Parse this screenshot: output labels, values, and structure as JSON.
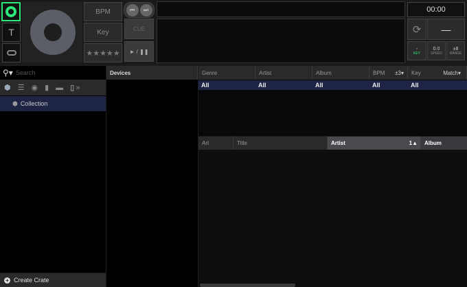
{
  "deck": {
    "bpm_label": "BPM",
    "key_label": "Key",
    "rating": "★★★★★",
    "cue_label": "CUE",
    "play_pause_label": "► / ❚❚",
    "time": "00:00",
    "pitch_value": "—",
    "key_value": "-",
    "key_label_small": "KEY",
    "speed_value": "0.0",
    "speed_label": "SPEED",
    "range_value": "±8",
    "range_label": "RANGE"
  },
  "browser": {
    "search_placeholder": "Search",
    "more": "»",
    "collection": "Collection",
    "create_crate": "Create Crate",
    "devices": "Devices",
    "filters": {
      "headers": [
        "Genre",
        "Artist",
        "Album",
        "BPM",
        "Key"
      ],
      "bpm_range": "±3▾",
      "key_match": "Match▾",
      "values": [
        "All",
        "All",
        "All",
        "All",
        "All"
      ]
    },
    "tracks": {
      "headers": [
        "Art",
        "Title",
        "Artist",
        "Album"
      ],
      "sort_indicator": "1▲"
    }
  },
  "colors": {
    "accent": "#2ee87a",
    "selection": "#1e2544"
  }
}
